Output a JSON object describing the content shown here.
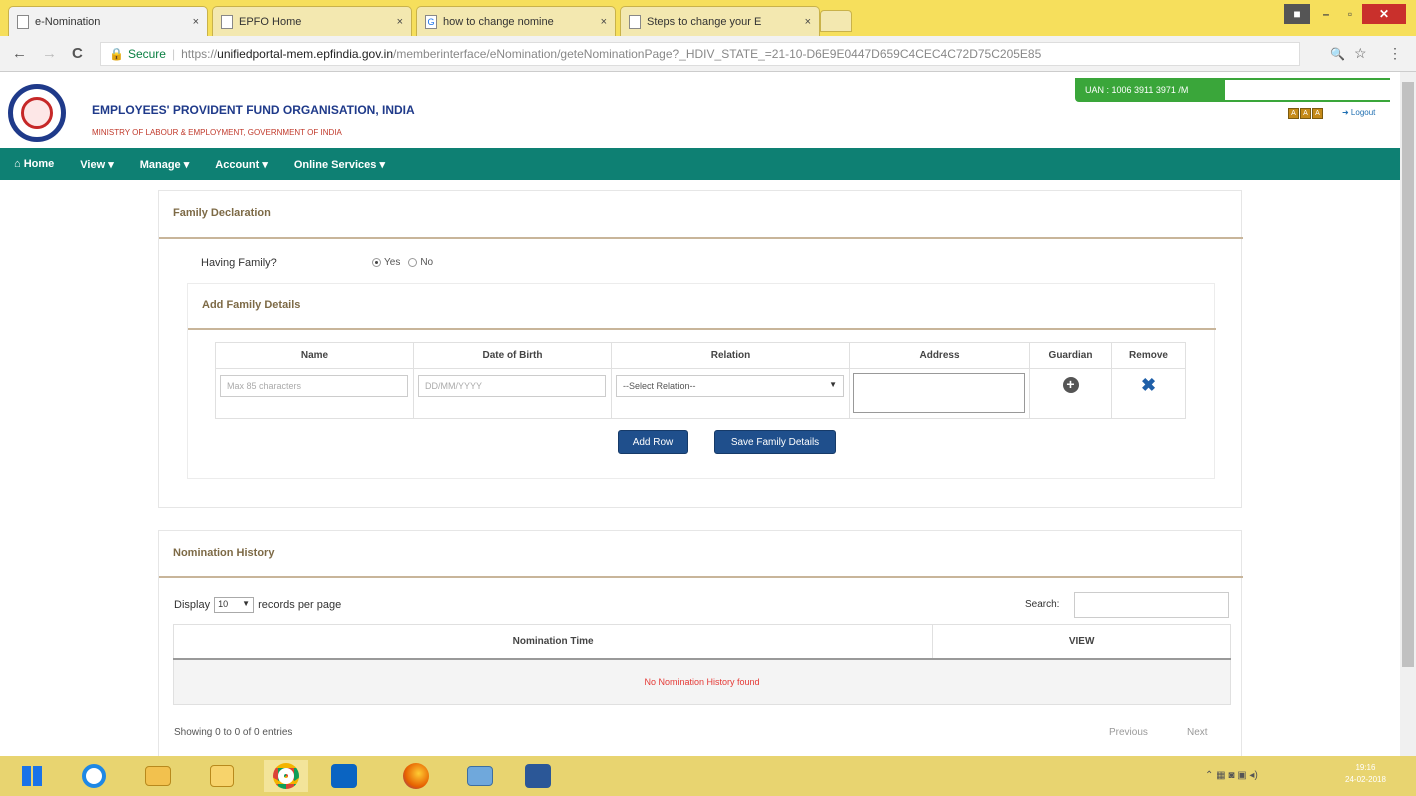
{
  "browser": {
    "tabs": [
      {
        "label": "e-Nomination",
        "icon": "doc-icon"
      },
      {
        "label": "EPFO Home",
        "icon": "doc-icon"
      },
      {
        "label": "how to change nomine",
        "icon": "google-icon"
      },
      {
        "label": "Steps to change your E",
        "icon": "page-icon"
      }
    ],
    "tab_close": "×",
    "back": "←",
    "forward": "→",
    "reload": "C",
    "secure_label": "Secure",
    "url_scheme": "https://",
    "url_host": "unifiedportal-mem.epfindia.gov.in",
    "url_path": "/memberinterface/eNomination/geteNominationPage?_HDIV_STATE_=21-10-D6E9E0447D659C4CEC4C72D75C205E85",
    "zoom_icon": "🔍",
    "star_icon": "☆",
    "menu_icon": "⋮",
    "win_min": "–",
    "win_max": "▫",
    "win_close": "✕"
  },
  "header": {
    "org_name": "EMPLOYEES' PROVIDENT FUND ORGANISATION, INDIA",
    "ministry": "MINISTRY OF LABOUR & EMPLOYMENT, GOVERNMENT OF INDIA",
    "uan": "UAN : 1006 3911 3971 /M",
    "font_buttons": [
      "A",
      "A",
      "A"
    ],
    "logout": "➜ Logout"
  },
  "nav": {
    "items": [
      "⌂ Home",
      "View ▾",
      "Manage ▾",
      "Account ▾",
      "Online Services ▾"
    ]
  },
  "family": {
    "title": "Family Declaration",
    "having_family_label": "Having Family?",
    "yes": "Yes",
    "no": "No",
    "details_title": "Add Family Details",
    "columns": [
      "Name",
      "Date of Birth",
      "Relation",
      "Address",
      "Guardian",
      "Remove"
    ],
    "name_placeholder": "Max 85 characters",
    "dob_placeholder": "DD/MM/YYYY",
    "relation_value": "--Select Relation--",
    "guardian_icon": "+",
    "remove_icon": "✖",
    "add_row": "Add Row",
    "save": "Save Family Details"
  },
  "history": {
    "title": "Nomination History",
    "display_prefix": "Display",
    "display_value": "10",
    "display_suffix": "records per page",
    "search_label": "Search:",
    "columns": [
      "Nomination Time",
      "VIEW"
    ],
    "empty": "No Nomination History found",
    "showing": "Showing 0 to 0 of 0 entries",
    "previous": "Previous",
    "next": "Next"
  },
  "taskbar": {
    "clock_time": "19:16",
    "clock_date": "24-02-2018"
  },
  "colors": {
    "nav_bg": "#0e8073",
    "button_bg": "#1f4f8c",
    "title_color": "#7d6a46",
    "uan_bg": "#3aa63a",
    "taskbar_bg": "#e8d470"
  }
}
